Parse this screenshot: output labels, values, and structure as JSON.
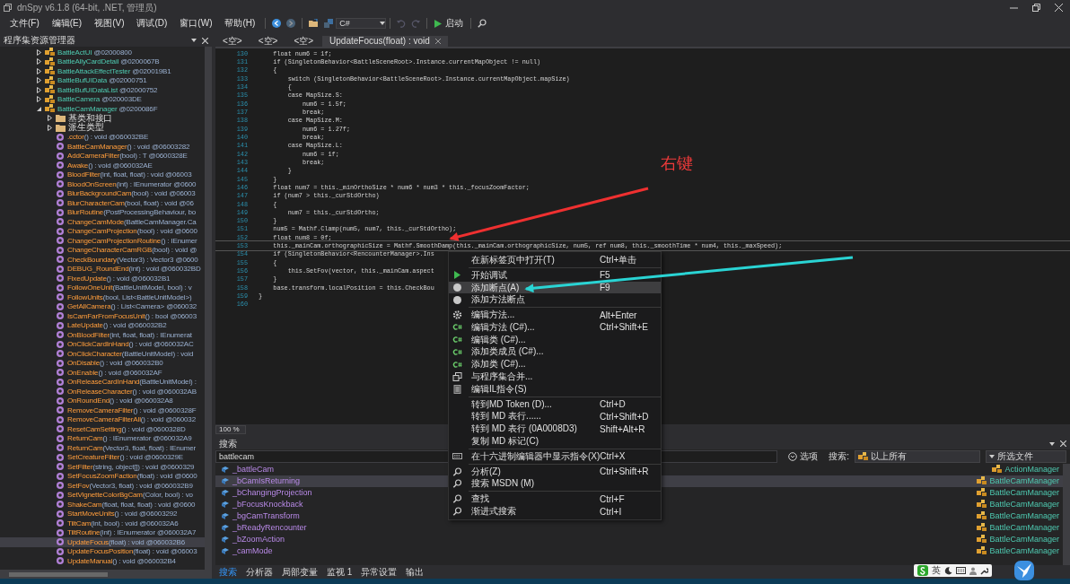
{
  "window": {
    "title": "dnSpy v6.1.8 (64-bit, .NET, 管理员)"
  },
  "menu": [
    "文件(F)",
    "编辑(E)",
    "视图(V)",
    "调试(D)",
    "窗口(W)",
    "帮助(H)"
  ],
  "toolbar": {
    "language": "C#",
    "run_label": "启动"
  },
  "explorer": {
    "title": "程序集资源管理器",
    "items": [
      {
        "kind": "class",
        "name": "BattleActUI",
        "rest": " @02000800",
        "expanded": false,
        "selected": false
      },
      {
        "kind": "class",
        "name": "BattleAllyCardDetail",
        "rest": " @0200067B",
        "expanded": false,
        "selected": false
      },
      {
        "kind": "class",
        "name": "BattleAttackEffectTester",
        "rest": " @020019B1",
        "expanded": false,
        "selected": false
      },
      {
        "kind": "class",
        "name": "BattleBufUIData",
        "rest": " @02000751",
        "expanded": false,
        "selected": false
      },
      {
        "kind": "class",
        "name": "BattleBufUIDataList",
        "rest": " @02000752",
        "expanded": false,
        "selected": false
      },
      {
        "kind": "class",
        "name": "BattleCamera",
        "rest": " @020003DE",
        "expanded": false,
        "selected": false
      },
      {
        "kind": "class",
        "name": "BattleCamManager",
        "rest": " @0200086F",
        "expanded": true,
        "selected": false,
        "children": [
          {
            "kind": "folder",
            "name": "基类和接口",
            "expanded": false,
            "selected": false
          },
          {
            "kind": "folder",
            "name": "派生类型",
            "expanded": false,
            "selected": false
          },
          {
            "kind": "method",
            "name": ".cctor",
            "rest": "() : void @060032BE",
            "selected": false
          },
          {
            "kind": "method",
            "name": "BattleCamManager",
            "rest": "() : void @06003282",
            "selected": false
          },
          {
            "kind": "method",
            "name": "AddCameraFilter",
            "rest": "(bool) : T @0600328E",
            "selected": false
          },
          {
            "kind": "method",
            "name": "Awake",
            "rest": "() : void @060032AE",
            "selected": false
          },
          {
            "kind": "method",
            "name": "BloodFilter",
            "rest": "(int, float, float) : void @06003",
            "selected": false
          },
          {
            "kind": "method",
            "name": "BloodOnScreen",
            "rest": "(int) : IEnumerator @0600",
            "selected": false
          },
          {
            "kind": "method",
            "name": "BlurBackgroundCam",
            "rest": "(bool) : void @06003",
            "selected": false
          },
          {
            "kind": "method",
            "name": "BlurCharacterCam",
            "rest": "(bool, float) : void @06",
            "selected": false
          },
          {
            "kind": "method",
            "name": "BlurRoutine",
            "rest": "(PostProcessingBehaviour, bo",
            "selected": false
          },
          {
            "kind": "method",
            "name": "ChangeCamMode",
            "rest": "(BattleCamManager.Ca",
            "selected": false
          },
          {
            "kind": "method",
            "name": "ChangeCamProjection",
            "rest": "(bool) : void @0600",
            "selected": false
          },
          {
            "kind": "method",
            "name": "ChangeCamProjectionRoutine",
            "rest": "() : IEnumer",
            "selected": false
          },
          {
            "kind": "method",
            "name": "ChangeCharacterCamRGB",
            "rest": "(bool) : void @",
            "selected": false
          },
          {
            "kind": "method",
            "name": "CheckBoundary",
            "rest": "(Vector3) : Vector3 @0600",
            "selected": false
          },
          {
            "kind": "method",
            "name": "DEBUG_RoundEnd",
            "rest": "(int) : void @060032BD",
            "selected": false
          },
          {
            "kind": "method",
            "name": "FixedUpdate",
            "rest": "() : void @060032B1",
            "selected": false
          },
          {
            "kind": "method",
            "name": "FollowOneUnit",
            "rest": "(BattleUnitModel, bool) : v",
            "selected": false
          },
          {
            "kind": "method",
            "name": "FollowUnits",
            "rest": "(bool, List<BattleUnitModel>)",
            "selected": false
          },
          {
            "kind": "method",
            "name": "GetAllCamera",
            "rest": "() : List<Camera> @060032",
            "selected": false
          },
          {
            "kind": "method",
            "name": "IsCamFarFromFocusUnit",
            "rest": "() : bool @06003",
            "selected": false
          },
          {
            "kind": "method",
            "name": "LateUpdate",
            "rest": "() : void @060032B2",
            "selected": false
          },
          {
            "kind": "method",
            "name": "OnBloodFilter",
            "rest": "(int, float, float) : IEnumerat",
            "selected": false
          },
          {
            "kind": "method",
            "name": "OnClickCardInHand",
            "rest": "() : void @060032AC",
            "selected": false
          },
          {
            "kind": "method",
            "name": "OnClickCharacter",
            "rest": "(BattleUnitModel) : void",
            "selected": false
          },
          {
            "kind": "method",
            "name": "OnDisable",
            "rest": "() : void @060032B0",
            "selected": false
          },
          {
            "kind": "method",
            "name": "OnEnable",
            "rest": "() : void @060032AF",
            "selected": false
          },
          {
            "kind": "method",
            "name": "OnReleaseCardInHand",
            "rest": "(BattleUnitModel) :",
            "selected": false
          },
          {
            "kind": "method",
            "name": "OnReleaseCharacter",
            "rest": "() : void @060032AB",
            "selected": false
          },
          {
            "kind": "method",
            "name": "OnRoundEnd",
            "rest": "() : void @060032A8",
            "selected": false
          },
          {
            "kind": "method",
            "name": "RemoveCameraFilter",
            "rest": "() : void @0600328F",
            "selected": false
          },
          {
            "kind": "method",
            "name": "RemoveCameraFilterAll",
            "rest": "() : void @060032",
            "selected": false
          },
          {
            "kind": "method",
            "name": "ResetCamSetting",
            "rest": "() : void @0600328D",
            "selected": false
          },
          {
            "kind": "method",
            "name": "ReturnCam",
            "rest": "() : IEnumerator @060032A9",
            "selected": false
          },
          {
            "kind": "method",
            "name": "ReturnCam",
            "rest": "(Vector3, float, float) : IEnumer",
            "selected": false
          },
          {
            "kind": "method",
            "name": "SetCreatureFilter",
            "rest": "() : void @0600329E",
            "selected": false
          },
          {
            "kind": "method",
            "name": "SetFilter",
            "rest": "(string, object[]) : void @0600329",
            "selected": false
          },
          {
            "kind": "method",
            "name": "SetFocusZoomFaction",
            "rest": "(float) : void @0600",
            "selected": false
          },
          {
            "kind": "method",
            "name": "SetFov",
            "rest": "(Vector3, float) : void @060032B9",
            "selected": false
          },
          {
            "kind": "method",
            "name": "SetVignetteColorBgCam",
            "rest": "(Color, bool) : vo",
            "selected": false
          },
          {
            "kind": "method",
            "name": "ShakeCam",
            "rest": "(float, float, float) : void @0600",
            "selected": false
          },
          {
            "kind": "method",
            "name": "StartMoveUnits",
            "rest": "() : void @06003292",
            "selected": false
          },
          {
            "kind": "method",
            "name": "TiltCam",
            "rest": "(int, bool) : void @060032A6",
            "selected": false
          },
          {
            "kind": "method",
            "name": "TiltRoutine",
            "rest": "(int) : IEnumerator @060032A7",
            "selected": false
          },
          {
            "kind": "method",
            "name": "UpdateFocus",
            "rest": "(float) : void @060032B6",
            "selected": true
          },
          {
            "kind": "method",
            "name": "UpdateFocusPosition",
            "rest": "(float) : void @06003",
            "selected": false
          },
          {
            "kind": "method",
            "name": "UpdateManual",
            "rest": "() : void @060032B4",
            "selected": false
          }
        ]
      }
    ]
  },
  "editor": {
    "tabs": [
      {
        "label": "<空>",
        "selected": false
      },
      {
        "label": "<空>",
        "selected": false
      },
      {
        "label": "<空>",
        "selected": false
      },
      {
        "label": "UpdateFocus(float) : void",
        "selected": true
      }
    ],
    "lines": [
      {
        "number": "130",
        "code": "    float num6 = 1f;",
        "current": false
      },
      {
        "number": "131",
        "code": "    if (SingletonBehavior<BattleSceneRoot>.Instance.currentMapObject != null)",
        "current": false
      },
      {
        "number": "132",
        "code": "    {",
        "current": false
      },
      {
        "number": "133",
        "code": "        switch (SingletonBehavior<BattleSceneRoot>.Instance.currentMapObject.mapSize)",
        "current": false
      },
      {
        "number": "134",
        "code": "        {",
        "current": false
      },
      {
        "number": "135",
        "code": "        case MapSize.S:",
        "current": false
      },
      {
        "number": "136",
        "code": "            num6 = 1.5f;",
        "current": false
      },
      {
        "number": "137",
        "code": "            break;",
        "current": false
      },
      {
        "number": "138",
        "code": "        case MapSize.M:",
        "current": false
      },
      {
        "number": "139",
        "code": "            num6 = 1.27f;",
        "current": false
      },
      {
        "number": "140",
        "code": "            break;",
        "current": false
      },
      {
        "number": "141",
        "code": "        case MapSize.L:",
        "current": false
      },
      {
        "number": "142",
        "code": "            num6 = 1f;",
        "current": false
      },
      {
        "number": "143",
        "code": "            break;",
        "current": false
      },
      {
        "number": "144",
        "code": "        }",
        "current": false
      },
      {
        "number": "145",
        "code": "    }",
        "current": false
      },
      {
        "number": "146",
        "code": "    float num7 = this._minOrthoSize * num6 * num3 * this._focusZoomFactor;",
        "current": false
      },
      {
        "number": "147",
        "code": "    if (num7 > this._curStdOrtho)",
        "current": false
      },
      {
        "number": "148",
        "code": "    {",
        "current": false
      },
      {
        "number": "149",
        "code": "        num7 = this._curStdOrtho;",
        "current": false
      },
      {
        "number": "150",
        "code": "    }",
        "current": false
      },
      {
        "number": "151",
        "code": "    num5 = Mathf.Clamp(num5, num7, this._curStdOrtho);",
        "current": false
      },
      {
        "number": "152",
        "code": "    float num8 = 0f;",
        "current": false
      },
      {
        "number": "153",
        "code": "    this._mainCam.orthographicSize = Mathf.SmoothDamp(this._mainCam.orthographicSize, num5, ref num8, this._smoothTime * num4, this._maxSpeed);",
        "current": true
      },
      {
        "number": "154",
        "code": "    if (SingletonBehavior<RencounterManager>.Ins",
        "current": false
      },
      {
        "number": "155",
        "code": "    {",
        "current": false
      },
      {
        "number": "156",
        "code": "        this.SetFov(vector, this._mainCam.aspect",
        "current": false
      },
      {
        "number": "157",
        "code": "    }",
        "current": false
      },
      {
        "number": "158",
        "code": "    base.transform.localPosition = this.CheckBou",
        "current": false
      },
      {
        "number": "159",
        "code": "}",
        "current": false
      },
      {
        "number": "160",
        "current": false
      }
    ],
    "zoom": "100 %"
  },
  "context_menu": {
    "groups": [
      [
        {
          "kind": "plain",
          "label": "在新标签页中打开(T)",
          "shortcut": "Ctrl+单击",
          "selected": false
        }
      ],
      [
        {
          "kind": "debug",
          "label": "开始调试",
          "shortcut": "F5",
          "selected": false
        },
        {
          "kind": "breakpoint",
          "label": "添加断点(A)",
          "shortcut": "F9",
          "selected": true
        },
        {
          "kind": "breakpoint",
          "label": "添加方法断点",
          "selected": false
        }
      ],
      [
        {
          "kind": "settings",
          "label": "编辑方法...",
          "shortcut": "Alt+Enter",
          "selected": false
        },
        {
          "kind": "csharp",
          "label": "编辑方法 (C#)...",
          "shortcut": "Ctrl+Shift+E",
          "selected": false
        },
        {
          "kind": "csharp",
          "label": "编辑类 (C#)...",
          "selected": false
        },
        {
          "kind": "csharp",
          "label": "添加类成员 (C#)...",
          "selected": false
        },
        {
          "kind": "csharp",
          "label": "添加类 (C#)...",
          "selected": false
        },
        {
          "kind": "merge",
          "label": "与程序集合并...",
          "selected": false
        },
        {
          "kind": "il",
          "label": "编辑IL指令(S)",
          "selected": false
        }
      ],
      [
        {
          "kind": "plain",
          "label": "转到MD Token (D)...",
          "shortcut": "Ctrl+D",
          "selected": false
        },
        {
          "kind": "plain",
          "label": "转到 MD 表行......",
          "shortcut": "Ctrl+Shift+D",
          "selected": false
        },
        {
          "kind": "plain",
          "label": "转到 MD 表行 (0A0008D3)",
          "shortcut": "Shift+Alt+R",
          "selected": false
        },
        {
          "kind": "plain",
          "label": "复制 MD 标记(C)",
          "selected": false
        }
      ],
      [
        {
          "kind": "hex",
          "label": "在十六进制编辑器中显示指令(X)",
          "shortcut": "Ctrl+X",
          "selected": false
        }
      ],
      [
        {
          "kind": "search",
          "label": "分析(Z)",
          "shortcut": "Ctrl+Shift+R",
          "selected": false
        },
        {
          "kind": "search",
          "label": "搜索 MSDN (M)",
          "selected": false
        }
      ],
      [
        {
          "kind": "search",
          "label": "查找",
          "shortcut": "Ctrl+F",
          "selected": false
        },
        {
          "kind": "search",
          "label": "渐进式搜索",
          "shortcut": "Ctrl+I",
          "selected": false
        }
      ]
    ]
  },
  "annotation": {
    "label": "右键"
  },
  "search": {
    "title": "搜索",
    "query": "battlecam",
    "options_label": "选项",
    "scope_label": "搜索:",
    "scope": "以上所有",
    "filter": "所选文件",
    "results": [
      {
        "name": "_battleCam",
        "location": "ActionManager",
        "selected": false
      },
      {
        "name": "_bCamIsReturning",
        "location": "BattleCamManager",
        "selected": true
      },
      {
        "name": "_bChangingProjection",
        "location": "BattleCamManager",
        "selected": false
      },
      {
        "name": "_bFocusKnockback",
        "location": "BattleCamManager",
        "selected": false
      },
      {
        "name": "_bgCamTransform",
        "location": "BattleCamManager",
        "selected": false
      },
      {
        "name": "_bReadyRencounter",
        "location": "BattleCamManager",
        "selected": false
      },
      {
        "name": "_bZoomAction",
        "location": "BattleCamManager",
        "selected": false
      },
      {
        "name": "_camMode",
        "location": "BattleCamManager",
        "selected": false
      }
    ]
  },
  "bottom_tabs": [
    {
      "label": "搜索",
      "selected": true
    },
    {
      "label": "分析器",
      "selected": false
    },
    {
      "label": "局部变量",
      "selected": false
    },
    {
      "label": "监视 1",
      "selected": false
    },
    {
      "label": "异常设置",
      "selected": false
    },
    {
      "label": "输出",
      "selected": false
    }
  ],
  "ime": {
    "label": "英"
  }
}
